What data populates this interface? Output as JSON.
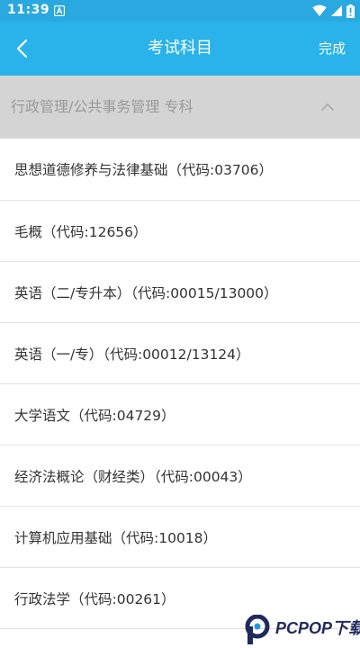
{
  "status_bar": {
    "time": "11:39",
    "icons": [
      "a-app-icon",
      "wifi-icon",
      "signal-icon",
      "battery-icon"
    ]
  },
  "header": {
    "back_icon": "chevron-left-icon",
    "title": "考试科目",
    "done_label": "完成"
  },
  "category": {
    "label": "行政管理/公共事务管理 专科",
    "expanded": true,
    "icon": "chevron-up-icon"
  },
  "subjects": [
    {
      "label": "思想道德修养与法律基础（代码:03706）"
    },
    {
      "label": "毛概（代码:12656）"
    },
    {
      "label": "英语（二/专升本）（代码:00015/13000）"
    },
    {
      "label": "英语（一/专）（代码:00012/13124）"
    },
    {
      "label": "大学语文（代码:04729）"
    },
    {
      "label": "经济法概论（财经类）（代码:00043）"
    },
    {
      "label": "计算机应用基础（代码:10018）"
    },
    {
      "label": "行政法学（代码:00261）"
    }
  ],
  "watermark": {
    "text": "PCPOP下载"
  },
  "colors": {
    "status_bar": "#2aa8e0",
    "app_bar": "#2ab2ea",
    "category_bg": "#d4d4d4",
    "category_text": "#9a9a9a",
    "item_text": "#333333",
    "divider": "#e2e2e2"
  }
}
